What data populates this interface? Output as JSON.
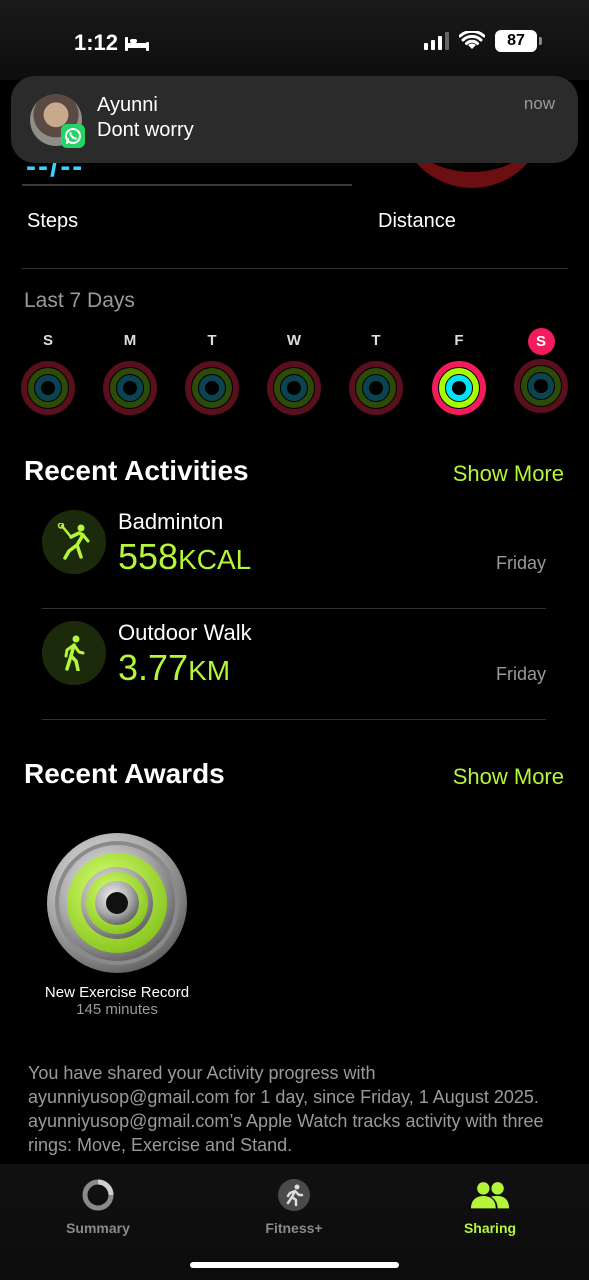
{
  "status_bar": {
    "time": "1:12",
    "battery": "87"
  },
  "summary": {
    "partial_number": "--/--",
    "steps_label": "Steps",
    "distance_label": "Distance"
  },
  "last7": {
    "title": "Last 7 Days",
    "days": [
      {
        "letter": "S",
        "today": false
      },
      {
        "letter": "M",
        "today": false
      },
      {
        "letter": "T",
        "today": false
      },
      {
        "letter": "W",
        "today": false
      },
      {
        "letter": "T",
        "today": false
      },
      {
        "letter": "F",
        "today": false
      },
      {
        "letter": "S",
        "today": true
      }
    ]
  },
  "recent_activities": {
    "title": "Recent Activities",
    "show_more": "Show More",
    "items": [
      {
        "name": "Badminton",
        "value": "558",
        "unit": "KCAL",
        "day": "Friday",
        "icon": "badminton-icon"
      },
      {
        "name": "Outdoor Walk",
        "value": "3.77",
        "unit": "KM",
        "day": "Friday",
        "icon": "walk-icon"
      }
    ]
  },
  "recent_awards": {
    "title": "Recent Awards",
    "show_more": "Show More",
    "items": [
      {
        "name": "New Exercise Record",
        "sub": "145 minutes",
        "icon": "exercise-record-medal-icon"
      }
    ]
  },
  "share_text": "You have shared your Activity progress with ayunniyusop@gmail.com for 1 day, since Friday, 1 August 2025. ayunniyusop@gmail.com’s Apple Watch tracks activity with three rings: Move, Exercise and Stand.",
  "tabs": [
    {
      "label": "Summary",
      "icon": "summary-ring-icon",
      "active": false
    },
    {
      "label": "Fitness+",
      "icon": "fitness-plus-icon",
      "active": false
    },
    {
      "label": "Sharing",
      "icon": "sharing-people-icon",
      "active": true
    }
  ],
  "notification": {
    "title": "Ayunni",
    "body": "Dont worry",
    "time": "now",
    "app_icon": "whatsapp-icon"
  },
  "colors": {
    "accent": "#b5f53a",
    "move": "#f21b5b",
    "exercise": "#a6ff00",
    "stand": "#00e5ff",
    "today_badge": "#f21b5b"
  }
}
